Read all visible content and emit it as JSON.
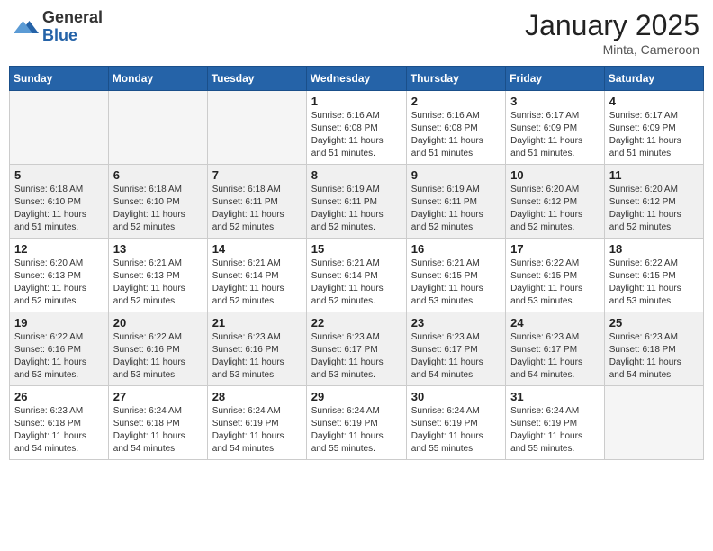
{
  "header": {
    "logo_general": "General",
    "logo_blue": "Blue",
    "month_title": "January 2025",
    "location": "Minta, Cameroon"
  },
  "weekdays": [
    "Sunday",
    "Monday",
    "Tuesday",
    "Wednesday",
    "Thursday",
    "Friday",
    "Saturday"
  ],
  "weeks": [
    [
      {
        "day": "",
        "info": ""
      },
      {
        "day": "",
        "info": ""
      },
      {
        "day": "",
        "info": ""
      },
      {
        "day": "1",
        "info": "Sunrise: 6:16 AM\nSunset: 6:08 PM\nDaylight: 11 hours\nand 51 minutes."
      },
      {
        "day": "2",
        "info": "Sunrise: 6:16 AM\nSunset: 6:08 PM\nDaylight: 11 hours\nand 51 minutes."
      },
      {
        "day": "3",
        "info": "Sunrise: 6:17 AM\nSunset: 6:09 PM\nDaylight: 11 hours\nand 51 minutes."
      },
      {
        "day": "4",
        "info": "Sunrise: 6:17 AM\nSunset: 6:09 PM\nDaylight: 11 hours\nand 51 minutes."
      }
    ],
    [
      {
        "day": "5",
        "info": "Sunrise: 6:18 AM\nSunset: 6:10 PM\nDaylight: 11 hours\nand 51 minutes."
      },
      {
        "day": "6",
        "info": "Sunrise: 6:18 AM\nSunset: 6:10 PM\nDaylight: 11 hours\nand 52 minutes."
      },
      {
        "day": "7",
        "info": "Sunrise: 6:18 AM\nSunset: 6:11 PM\nDaylight: 11 hours\nand 52 minutes."
      },
      {
        "day": "8",
        "info": "Sunrise: 6:19 AM\nSunset: 6:11 PM\nDaylight: 11 hours\nand 52 minutes."
      },
      {
        "day": "9",
        "info": "Sunrise: 6:19 AM\nSunset: 6:11 PM\nDaylight: 11 hours\nand 52 minutes."
      },
      {
        "day": "10",
        "info": "Sunrise: 6:20 AM\nSunset: 6:12 PM\nDaylight: 11 hours\nand 52 minutes."
      },
      {
        "day": "11",
        "info": "Sunrise: 6:20 AM\nSunset: 6:12 PM\nDaylight: 11 hours\nand 52 minutes."
      }
    ],
    [
      {
        "day": "12",
        "info": "Sunrise: 6:20 AM\nSunset: 6:13 PM\nDaylight: 11 hours\nand 52 minutes."
      },
      {
        "day": "13",
        "info": "Sunrise: 6:21 AM\nSunset: 6:13 PM\nDaylight: 11 hours\nand 52 minutes."
      },
      {
        "day": "14",
        "info": "Sunrise: 6:21 AM\nSunset: 6:14 PM\nDaylight: 11 hours\nand 52 minutes."
      },
      {
        "day": "15",
        "info": "Sunrise: 6:21 AM\nSunset: 6:14 PM\nDaylight: 11 hours\nand 52 minutes."
      },
      {
        "day": "16",
        "info": "Sunrise: 6:21 AM\nSunset: 6:15 PM\nDaylight: 11 hours\nand 53 minutes."
      },
      {
        "day": "17",
        "info": "Sunrise: 6:22 AM\nSunset: 6:15 PM\nDaylight: 11 hours\nand 53 minutes."
      },
      {
        "day": "18",
        "info": "Sunrise: 6:22 AM\nSunset: 6:15 PM\nDaylight: 11 hours\nand 53 minutes."
      }
    ],
    [
      {
        "day": "19",
        "info": "Sunrise: 6:22 AM\nSunset: 6:16 PM\nDaylight: 11 hours\nand 53 minutes."
      },
      {
        "day": "20",
        "info": "Sunrise: 6:22 AM\nSunset: 6:16 PM\nDaylight: 11 hours\nand 53 minutes."
      },
      {
        "day": "21",
        "info": "Sunrise: 6:23 AM\nSunset: 6:16 PM\nDaylight: 11 hours\nand 53 minutes."
      },
      {
        "day": "22",
        "info": "Sunrise: 6:23 AM\nSunset: 6:17 PM\nDaylight: 11 hours\nand 53 minutes."
      },
      {
        "day": "23",
        "info": "Sunrise: 6:23 AM\nSunset: 6:17 PM\nDaylight: 11 hours\nand 54 minutes."
      },
      {
        "day": "24",
        "info": "Sunrise: 6:23 AM\nSunset: 6:17 PM\nDaylight: 11 hours\nand 54 minutes."
      },
      {
        "day": "25",
        "info": "Sunrise: 6:23 AM\nSunset: 6:18 PM\nDaylight: 11 hours\nand 54 minutes."
      }
    ],
    [
      {
        "day": "26",
        "info": "Sunrise: 6:23 AM\nSunset: 6:18 PM\nDaylight: 11 hours\nand 54 minutes."
      },
      {
        "day": "27",
        "info": "Sunrise: 6:24 AM\nSunset: 6:18 PM\nDaylight: 11 hours\nand 54 minutes."
      },
      {
        "day": "28",
        "info": "Sunrise: 6:24 AM\nSunset: 6:19 PM\nDaylight: 11 hours\nand 54 minutes."
      },
      {
        "day": "29",
        "info": "Sunrise: 6:24 AM\nSunset: 6:19 PM\nDaylight: 11 hours\nand 55 minutes."
      },
      {
        "day": "30",
        "info": "Sunrise: 6:24 AM\nSunset: 6:19 PM\nDaylight: 11 hours\nand 55 minutes."
      },
      {
        "day": "31",
        "info": "Sunrise: 6:24 AM\nSunset: 6:19 PM\nDaylight: 11 hours\nand 55 minutes."
      },
      {
        "day": "",
        "info": ""
      }
    ]
  ]
}
